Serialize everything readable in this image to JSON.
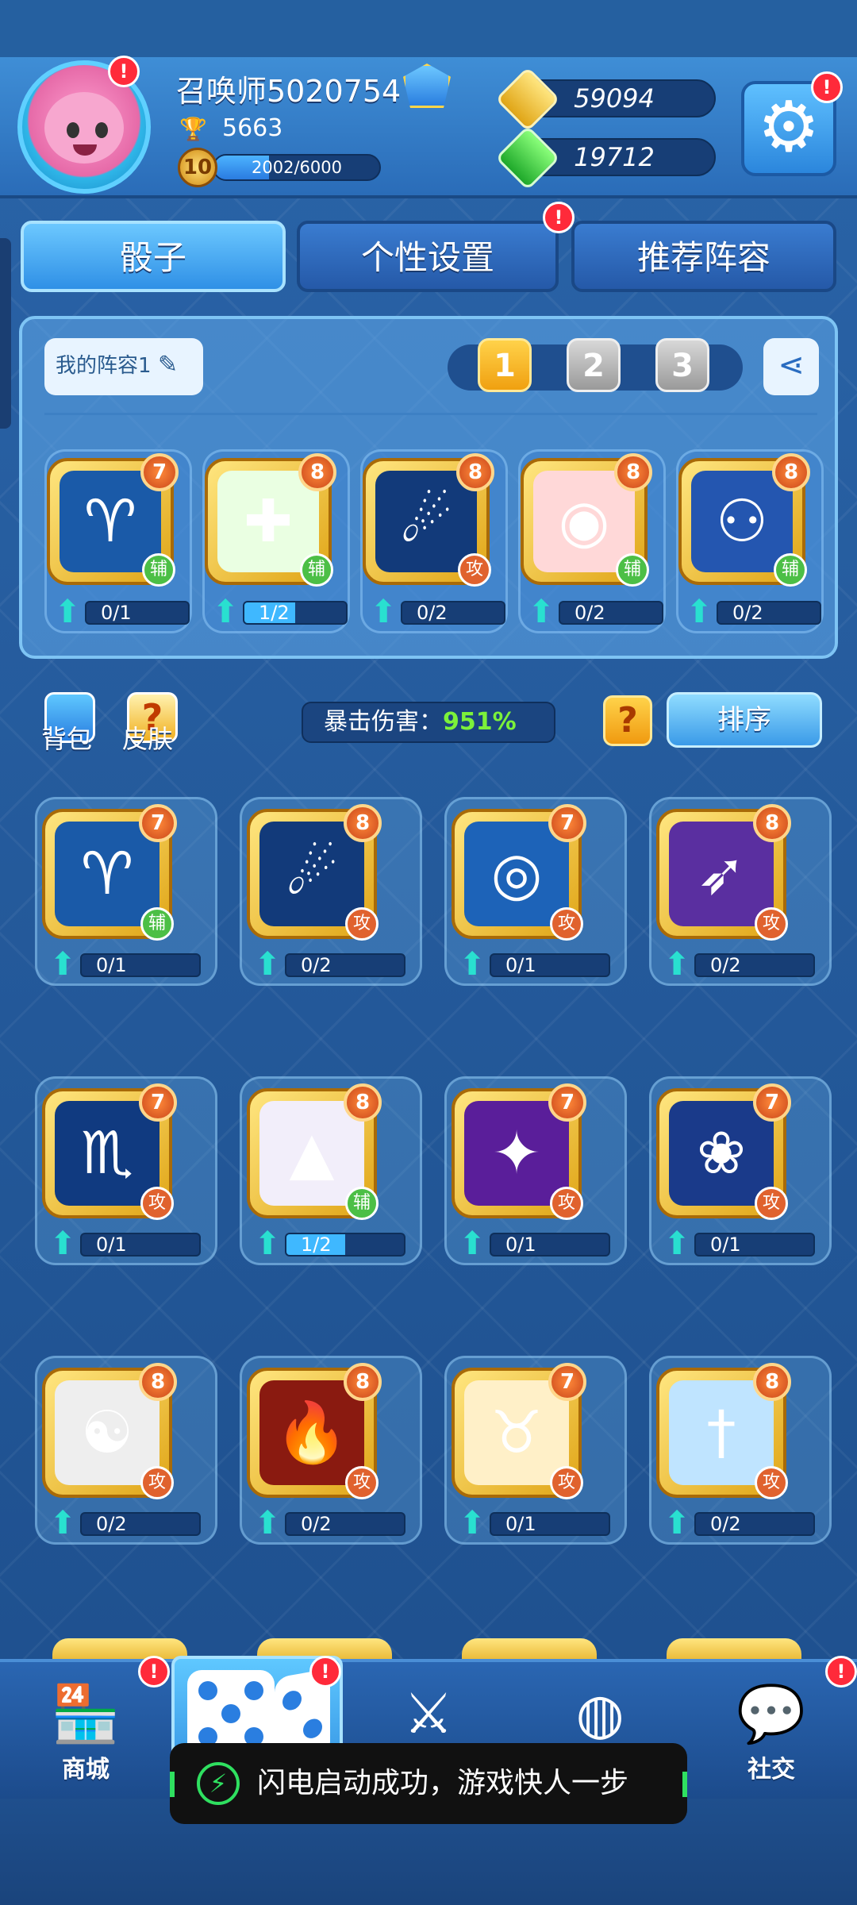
{
  "profile": {
    "username": "召唤师5020754",
    "trophies": "5663",
    "level": "10",
    "xp_text": "2002/6000",
    "xp_fraction": 0.3337
  },
  "currency": {
    "gold": "59094",
    "gems": "19712"
  },
  "tabs": [
    {
      "label": "骰子",
      "active": true
    },
    {
      "label": "个性设置",
      "active": false
    },
    {
      "label": "推荐阵容",
      "active": false
    }
  ],
  "lineup": {
    "name": "我的阵容1",
    "pages": [
      "1",
      "2",
      "3"
    ],
    "active_page": "1",
    "cards": [
      {
        "icon": "ram-icon",
        "glyph": "♈",
        "level": "7",
        "role": "辅",
        "role_type": "sup",
        "progress": "0/1",
        "fill": 0,
        "bg": "#1a5aa8"
      },
      {
        "icon": "plus-cross-icon",
        "glyph": "✚",
        "level": "8",
        "role": "辅",
        "role_type": "sup",
        "progress": "1/2",
        "fill": 0.5,
        "bg": "#eaffe2"
      },
      {
        "icon": "spirit-icon",
        "glyph": "☄",
        "level": "8",
        "role": "攻",
        "role_type": "atk",
        "progress": "0/2",
        "fill": 0,
        "bg": "#123a7a"
      },
      {
        "icon": "red-totem-icon",
        "glyph": "◉",
        "level": "8",
        "role": "辅",
        "role_type": "sup",
        "progress": "0/2",
        "fill": 0,
        "bg": "#ffd8d8"
      },
      {
        "icon": "twin-figure-icon",
        "glyph": "⚇",
        "level": "8",
        "role": "辅",
        "role_type": "sup",
        "progress": "0/2",
        "fill": 0,
        "bg": "#2456b0"
      }
    ]
  },
  "bag": {
    "label": "背包"
  },
  "skin": {
    "label": "皮肤"
  },
  "crit": {
    "label": "暴击伤害：",
    "value": "951%"
  },
  "sort_label": "排序",
  "help_label": "?",
  "collection": [
    {
      "icon": "ram-icon",
      "glyph": "♈",
      "level": "7",
      "role": "辅",
      "role_type": "sup",
      "progress": "0/1",
      "fill": 0,
      "bg": "#1a5aa8"
    },
    {
      "icon": "spirit-icon",
      "glyph": "☄",
      "level": "8",
      "role": "攻",
      "role_type": "atk",
      "progress": "0/2",
      "fill": 0,
      "bg": "#123a7a"
    },
    {
      "icon": "whirlwind-icon",
      "glyph": "◎",
      "level": "7",
      "role": "攻",
      "role_type": "atk",
      "progress": "0/1",
      "fill": 0,
      "bg": "#1d63b8"
    },
    {
      "icon": "archer-icon",
      "glyph": "➶",
      "level": "8",
      "role": "攻",
      "role_type": "atk",
      "progress": "0/2",
      "fill": 0,
      "bg": "#5a2fa0"
    },
    {
      "icon": "scorpion-icon",
      "glyph": "♏",
      "level": "7",
      "role": "攻",
      "role_type": "atk",
      "progress": "0/1",
      "fill": 0,
      "bg": "#103a80"
    },
    {
      "icon": "witch-hat-icon",
      "glyph": "▲",
      "level": "8",
      "role": "辅",
      "role_type": "sup",
      "progress": "1/2",
      "fill": 0.5,
      "bg": "#f2eefa"
    },
    {
      "icon": "purple-rays-icon",
      "glyph": "✦",
      "level": "7",
      "role": "攻",
      "role_type": "atk",
      "progress": "0/1",
      "fill": 0,
      "bg": "#5a1e9a"
    },
    {
      "icon": "lotus-icon",
      "glyph": "❀",
      "level": "7",
      "role": "攻",
      "role_type": "atk",
      "progress": "0/1",
      "fill": 0,
      "bg": "#1a3a8a"
    },
    {
      "icon": "yin-yang-icon",
      "glyph": "☯",
      "level": "8",
      "role": "攻",
      "role_type": "atk",
      "progress": "0/2",
      "fill": 0,
      "bg": "#eeeeee"
    },
    {
      "icon": "fire-icon",
      "glyph": "🔥",
      "level": "8",
      "role": "攻",
      "role_type": "atk",
      "progress": "0/2",
      "fill": 0,
      "bg": "#8a1a10"
    },
    {
      "icon": "bull-icon",
      "glyph": "♉",
      "level": "7",
      "role": "攻",
      "role_type": "atk",
      "progress": "0/1",
      "fill": 0,
      "bg": "#fff0c8"
    },
    {
      "icon": "sword-icon",
      "glyph": "†",
      "level": "8",
      "role": "攻",
      "role_type": "atk",
      "progress": "0/2",
      "fill": 0,
      "bg": "#bfe4ff"
    }
  ],
  "nav": [
    {
      "label": "商城",
      "icon": "shop-icon",
      "glyph": "🏪"
    },
    {
      "label": "",
      "icon": "dice-icon",
      "glyph": ""
    },
    {
      "label": "",
      "icon": "swords-icon",
      "glyph": "⚔"
    },
    {
      "label": "",
      "icon": "planet-icon",
      "glyph": "🪐"
    },
    {
      "label": "社交",
      "icon": "chat-icon",
      "glyph": "💬"
    }
  ],
  "toast": {
    "text": "闪电启动成功，游戏快人一步"
  },
  "colors": {
    "accent": "#3fb8ff",
    "alert": "#ff2a3a",
    "crit_value": "#7cf23a",
    "attack_role": "#e0622e",
    "support_role": "#4cbf46"
  }
}
